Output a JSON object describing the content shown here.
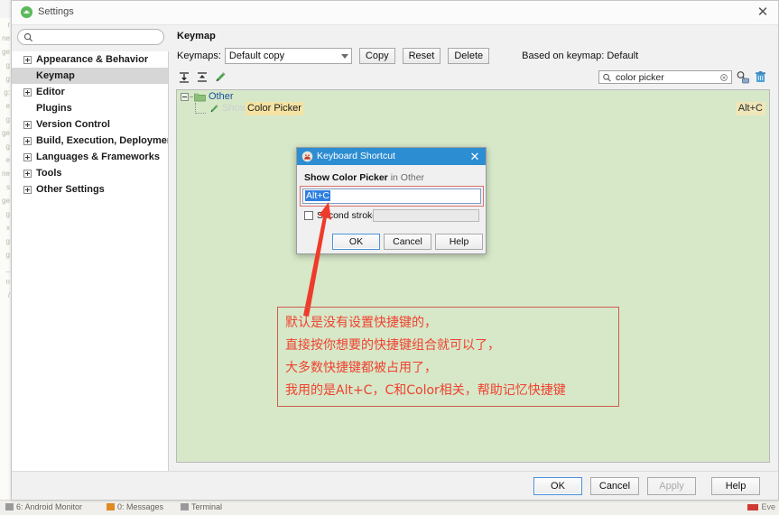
{
  "window": {
    "title": "Settings",
    "close_label": "✕",
    "icon": "android-studio-icon"
  },
  "search": {
    "value": "",
    "placeholder": "",
    "icon": "search-icon"
  },
  "sidebar": {
    "items": [
      {
        "label": "Appearance & Behavior",
        "expandable": true,
        "selected": false
      },
      {
        "label": "Keymap",
        "expandable": false,
        "selected": true
      },
      {
        "label": "Editor",
        "expandable": true,
        "selected": false
      },
      {
        "label": "Plugins",
        "expandable": false,
        "selected": false
      },
      {
        "label": "Version Control",
        "expandable": true,
        "selected": false
      },
      {
        "label": "Build, Execution, Deployment",
        "expandable": true,
        "selected": false
      },
      {
        "label": "Languages & Frameworks",
        "expandable": true,
        "selected": false
      },
      {
        "label": "Tools",
        "expandable": true,
        "selected": false
      },
      {
        "label": "Other Settings",
        "expandable": true,
        "selected": false
      }
    ]
  },
  "pane": {
    "title": "Keymap",
    "keymaps_label": "Keymaps:",
    "keymap_selected": "Default copy",
    "copy_label": "Copy",
    "reset_label": "Reset",
    "delete_label": "Delete",
    "based_on": "Based on keymap: Default"
  },
  "tree_toolbar": {
    "expand_all_icon": "expand-all-icon",
    "collapse_all_icon": "collapse-all-icon",
    "edit_shortcut_icon": "edit-pencil-icon",
    "find_value": "color picker",
    "find_icon": "search-icon",
    "clear_icon": "clear-circle-icon",
    "find_by_shortcut_icon": "find-by-shortcut-icon",
    "filter_icon": "filter-trash-icon"
  },
  "tree": {
    "group": {
      "name": "Other",
      "icon": "folder-icon"
    },
    "action": {
      "prefix": "Show",
      "highlight": "Color Picker",
      "shortcut": "Alt+C",
      "icon": "color-picker-icon"
    }
  },
  "modal": {
    "title": "Keyboard Shortcut",
    "icon": "keyboard-shortcut-icon",
    "close_label": "✕",
    "description_action": "Show Color Picker",
    "description_suffix": " in Other",
    "shortcut_value": "Alt+C",
    "second_stroke_label": "Second stroke:",
    "second_stroke_value": "",
    "second_stroke_checked": false,
    "ok_label": "OK",
    "cancel_label": "Cancel",
    "help_label": "Help"
  },
  "footer": {
    "ok_label": "OK",
    "cancel_label": "Cancel",
    "apply_label": "Apply",
    "apply_disabled": true,
    "help_label": "Help"
  },
  "annotation": {
    "color": "#f0412f",
    "border_color": "#cf5c4e",
    "lines": [
      "默认是没有设置快捷键的，",
      "直接按你想要的快捷键组合就可以了，",
      "大多数快捷键都被占用了，",
      "我用的是Alt+C，C和Color相关，帮助记忆快捷键"
    ]
  },
  "ide_status_bar": {
    "items": [
      "6: Android Monitor",
      "0: Messages",
      "Terminal"
    ],
    "right_text": "Eve"
  },
  "colors": {
    "tree_background": "#d6e8c8",
    "selection_blue": "#2f7fe0",
    "modal_title_blue": "#2d8dd2",
    "highlight_yellow": "#f5e3a3",
    "annotation_red": "#f0412f"
  }
}
